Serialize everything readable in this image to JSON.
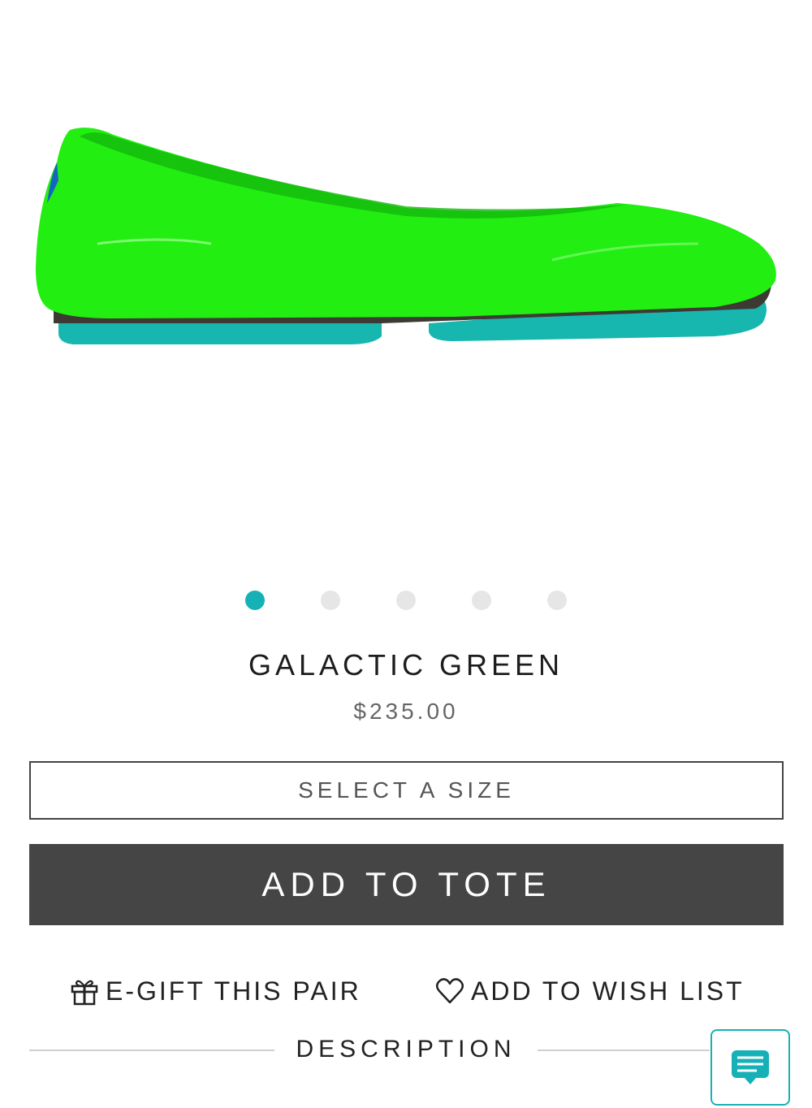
{
  "product": {
    "name": "GALACTIC GREEN",
    "price": "$235.00",
    "image": {
      "upper_color": "#22ee11",
      "sole_color": "#17b7b0"
    }
  },
  "carousel": {
    "total": 5,
    "active_index": 0,
    "active_color": "#16b1b6"
  },
  "size_select": {
    "label": "SELECT A SIZE"
  },
  "add_to_tote": {
    "label": "ADD TO TOTE"
  },
  "actions": {
    "egift_label": "E-GIFT THIS PAIR",
    "egift_icon": "gift-icon",
    "wishlist_label": "ADD TO WISH LIST",
    "wishlist_icon": "heart-icon"
  },
  "description": {
    "label": "DESCRIPTION"
  },
  "chat": {
    "icon": "chat-icon"
  }
}
